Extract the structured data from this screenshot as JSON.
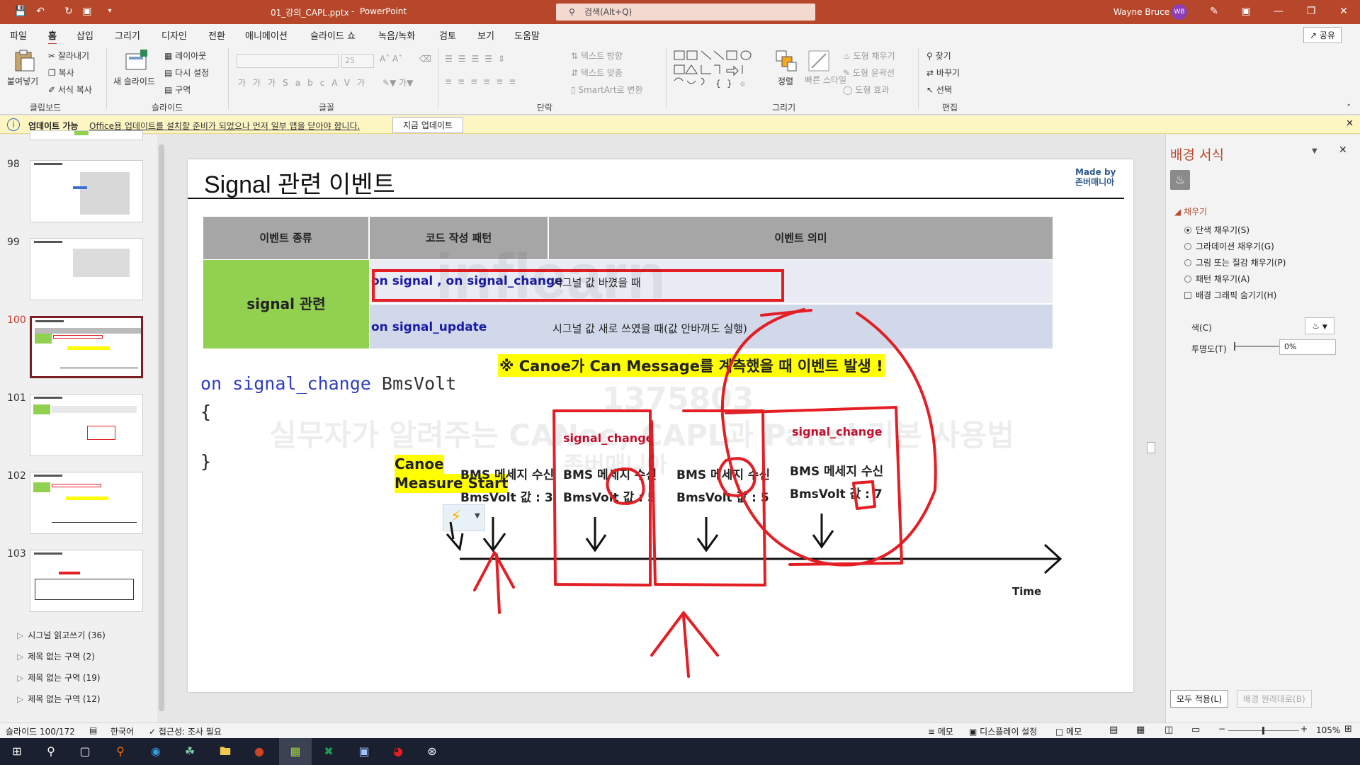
{
  "titlebar": {
    "filename": "01_강의_CAPL.pptx",
    "sep": "-",
    "app": "PowerPoint",
    "search_placeholder": "검색(Alt+Q)",
    "user": "Wayne Bruce",
    "avatar": "WB"
  },
  "menu": {
    "items": [
      "파일",
      "홈",
      "삽입",
      "그리기",
      "디자인",
      "전환",
      "애니메이션",
      "슬라이드 쇼",
      "녹음/녹화",
      "검토",
      "보기",
      "도움말"
    ],
    "share": "공유"
  },
  "ribbon": {
    "clipboard": {
      "paste": "붙여넣기",
      "cut": "잘라내기",
      "copy": "복사",
      "format_painter": "서식 복사",
      "group": "클립보드"
    },
    "slides": {
      "new_slide": "새 슬라이드",
      "layout": "레이아웃",
      "reset": "다시 설정",
      "section": "구역",
      "group": "슬라이드"
    },
    "font": {
      "size": "25",
      "group": "글꼴"
    },
    "paragraph": {
      "text_direction": "텍스트 방향",
      "align_text": "텍스트 맞춤",
      "smartart": "SmartArt로 변환",
      "group": "단락"
    },
    "drawing": {
      "arrange": "정렬",
      "quick_styles": "빠른 스타일",
      "shape_fill": "도형 채우기",
      "shape_outline": "도형 윤곽선",
      "shape_effects": "도형 효과",
      "group": "그리기"
    },
    "editing": {
      "find": "찾기",
      "replace": "바꾸기",
      "select": "선택",
      "group": "편집"
    }
  },
  "update_bar": {
    "title": "업데이트 가능",
    "message": "Office용 업데이트를 설치할 준비가 되었으나 먼저 일부 앱을 닫아야 합니다.",
    "button": "지금 업데이트"
  },
  "thumbnails": [
    {
      "num": "98"
    },
    {
      "num": "99"
    },
    {
      "num": "100"
    },
    {
      "num": "101"
    },
    {
      "num": "102"
    },
    {
      "num": "103"
    }
  ],
  "sections": [
    "시그널 읽고쓰기 (36)",
    "제목 없는 구역 (2)",
    "제목 없는 구역 (19)",
    "제목 없는 구역 (12)"
  ],
  "slide": {
    "title": "Signal 관련 이벤트",
    "made_by_1": "Made by",
    "made_by_2": "존버매니아",
    "table": {
      "headers": [
        "이벤트 종류",
        "코드 작성 패턴",
        "이벤트 의미"
      ],
      "group_label": "signal 관련",
      "rows": [
        {
          "pattern": "on signal , on signal_change",
          "meaning": "시그널 값 바꼈을 때"
        },
        {
          "pattern": "on signal_update",
          "meaning": "시그널 값 새로 쓰였을 때(값 안바껴도 실행)"
        }
      ]
    },
    "code": {
      "line1_kw": "on signal_change",
      "line1_name": "BmsVolt",
      "open": "{",
      "close": "}"
    },
    "note": "※ Canoe가 Can Message를 계측했을 때  이벤트 발생 !",
    "canoe_start": [
      "Canoe",
      "Measure Start"
    ],
    "events": [
      {
        "title": "BMS 메세지 수신",
        "value": "BmsVolt 값 : 3",
        "label": ""
      },
      {
        "title": "BMS 메세지 수신",
        "value": "BmsVolt 값 :  5",
        "label": "signal_change"
      },
      {
        "title": "BMS 메세지 수신",
        "value": "BmsVolt 값 :  5",
        "label": ""
      },
      {
        "title": "BMS 메세지 수신",
        "value": "BmsVolt 값 :  7",
        "label": "signal_change"
      }
    ],
    "time_label": "Time",
    "watermark": [
      "inflearn",
      "1375803",
      "실무자가 알려주는 CANoe, CAPL과 Panel 기본 사용법",
      "존버매니아"
    ]
  },
  "format_pane": {
    "title": "배경 서식",
    "fill_header": "채우기",
    "options": [
      "단색 채우기(S)",
      "그라데이션 채우기(G)",
      "그림 또는 질감 채우기(P)",
      "패턴 채우기(A)"
    ],
    "hide_graphics": "배경 그래픽 숨기기(H)",
    "color_label": "색(C)",
    "transparency_label": "투명도(T)",
    "transparency_value": "0%",
    "apply_all": "모두 적용(L)",
    "reset_bg": "배경 원래대로(B)"
  },
  "status": {
    "slide": "슬라이드 100/172",
    "lang": "한국어",
    "access": "접근성: 조사 필요",
    "notes": "메모",
    "display": "디스플레이 설정",
    "comments": "메모",
    "zoom": "105%"
  },
  "colors": {
    "accent": "#b7472a",
    "green": "#92d050",
    "header_gray": "#a6a6a6",
    "ink": "#e31e24",
    "yellow": "#ffff00",
    "code_blue": "#2f3fbf"
  }
}
